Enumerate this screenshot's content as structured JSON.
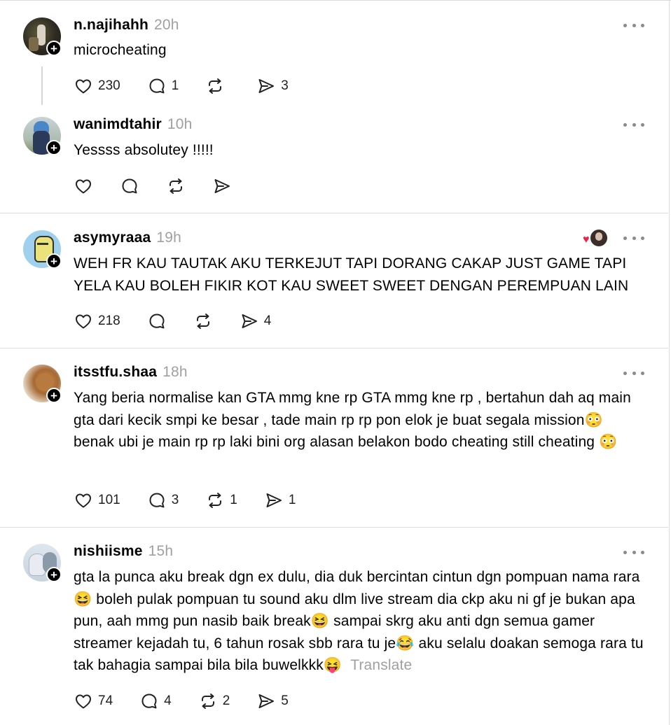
{
  "posts": [
    {
      "username": "n.najihahh",
      "time": "20h",
      "text": "microcheating",
      "likes": "230",
      "replies": "1",
      "reposts": "",
      "shares": "3"
    },
    {
      "username": "wanimdtahir",
      "time": "10h",
      "text": "Yessss absolutey !!!!!",
      "likes": "",
      "replies": "",
      "reposts": "",
      "shares": ""
    },
    {
      "username": "asymyraaa",
      "time": "19h",
      "text": "WEH FR KAU TAUTAK AKU TERKEJUT TAPI DORANG CAKAP JUST GAME TAPI YELA KAU BOLEH FIKIR KOT KAU SWEET SWEET DENGAN PEREMPUAN LAIN",
      "likes": "218",
      "replies": "",
      "reposts": "",
      "shares": "4"
    },
    {
      "username": "itsstfu.shaa",
      "time": "18h",
      "text": "Yang beria normalise kan GTA mmg kne rp GTA mmg kne rp , bertahun dah aq main gta dari kecik smpi ke besar , tade main rp rp pon elok je buat segala mission😳 benak ubi je main rp rp laki bini org alasan belakon bodo cheating still cheating 😳",
      "likes": "101",
      "replies": "3",
      "reposts": "1",
      "shares": "1"
    },
    {
      "username": "nishiisme",
      "time": "15h",
      "text": "gta la punca aku break dgn ex dulu, dia duk bercintan cintun dgn pompuan nama rara😆 boleh pulak pompuan tu sound aku dlm live stream dia ckp aku ni gf je bukan apa pun, aah mmg pun nasib baik break😆 sampai skrg aku anti dgn semua gamer streamer kejadah tu, 6 tahun rosak sbb rara tu je😂 aku selalu doakan semoga rara tu tak bahagia sampai bila bila buwelkkk😝",
      "translate": "Translate",
      "likes": "74",
      "replies": "4",
      "reposts": "2",
      "shares": "5"
    }
  ],
  "colors": {
    "heart": "#ee2244",
    "muted": "#a0a0a0",
    "divider": "#dcdcdc"
  }
}
